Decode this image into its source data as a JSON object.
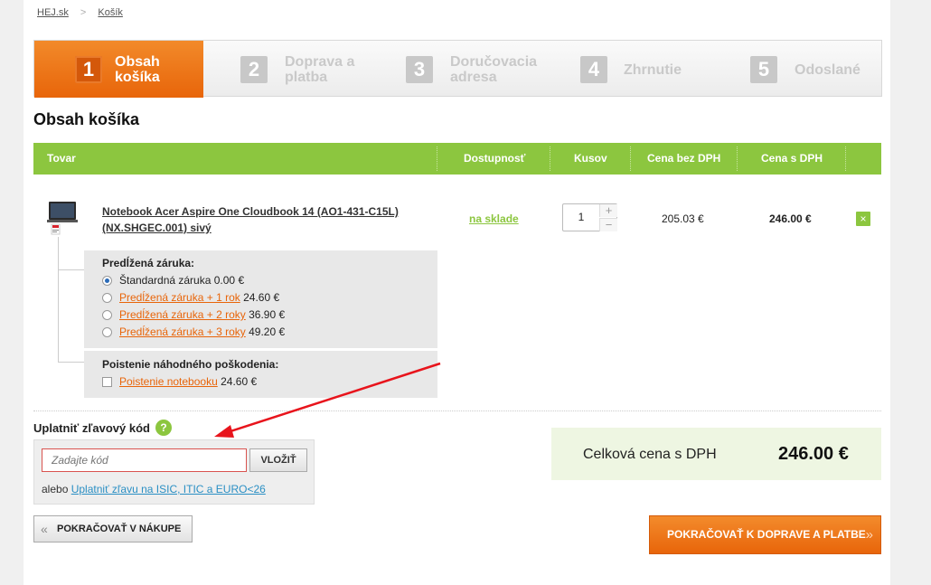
{
  "breadcrumb": {
    "home": "HEJ.sk",
    "separator": ">",
    "current": "Košík"
  },
  "steps": [
    {
      "number": "1",
      "line1": "Obsah",
      "line2": "košíka",
      "active": true
    },
    {
      "number": "2",
      "line1": "Doprava a",
      "line2": "platba",
      "active": false
    },
    {
      "number": "3",
      "line1": "Doručovacia",
      "line2": "adresa",
      "active": false
    },
    {
      "number": "4",
      "line1": "Zhrnutie",
      "line2": "",
      "active": false
    },
    {
      "number": "5",
      "line1": "Odoslané",
      "line2": "",
      "active": false
    }
  ],
  "page_title": "Obsah košíka",
  "table": {
    "headers": {
      "product": "Tovar",
      "availability": "Dostupnosť",
      "quantity": "Kusov",
      "price_without_vat": "Cena bez DPH",
      "price_with_vat": "Cena s DPH"
    },
    "item": {
      "name_line1": "Notebook Acer Aspire One Cloudbook 14 (AO1-431-C15L)",
      "name_line2": "(NX.SHGEC.001) sivý",
      "availability": "na sklade",
      "quantity": "1",
      "plus": "+",
      "minus": "−",
      "price_without_vat": "205.03 €",
      "price_with_vat": "246.00 €",
      "remove": "×"
    }
  },
  "warranty": {
    "title": "Predĺžená záruka:",
    "options": [
      {
        "label": "Štandardná záruka",
        "price": "0.00 €",
        "link": false,
        "checked": true
      },
      {
        "label": "Predĺžená záruka + 1 rok",
        "price": "24.60 €",
        "link": true,
        "checked": false
      },
      {
        "label": "Predĺžená záruka + 2 roky",
        "price": "36.90 €",
        "link": true,
        "checked": false
      },
      {
        "label": "Predĺžená záruka + 3 roky",
        "price": "49.20 €",
        "link": true,
        "checked": false
      }
    ]
  },
  "insurance": {
    "title": "Poistenie náhodného poškodenia:",
    "option": {
      "label": "Poistenie notebooku",
      "price": "24.60 €",
      "checked": false
    }
  },
  "coupon": {
    "title": "Uplatniť zľavový kód",
    "help": "?",
    "placeholder": "Zadajte kód",
    "button": "VLOŽIŤ",
    "note_prefix": "alebo",
    "note_link": "Uplatniť zľavu na ISIC, ITIC a EURO<26"
  },
  "total": {
    "label": "Celková cena s DPH",
    "value": "246.00 €"
  },
  "buttons": {
    "back": "POKRAČOVAŤ V NÁKUPE",
    "back_chevron": "«",
    "next": "POKRAČOVAŤ K DOPRAVE A PLATBE",
    "next_chevron": "»"
  },
  "colors": {
    "accent_orange": "#e8650a",
    "accent_green": "#8cc63f",
    "annotation_arrow": "#e8141c"
  }
}
